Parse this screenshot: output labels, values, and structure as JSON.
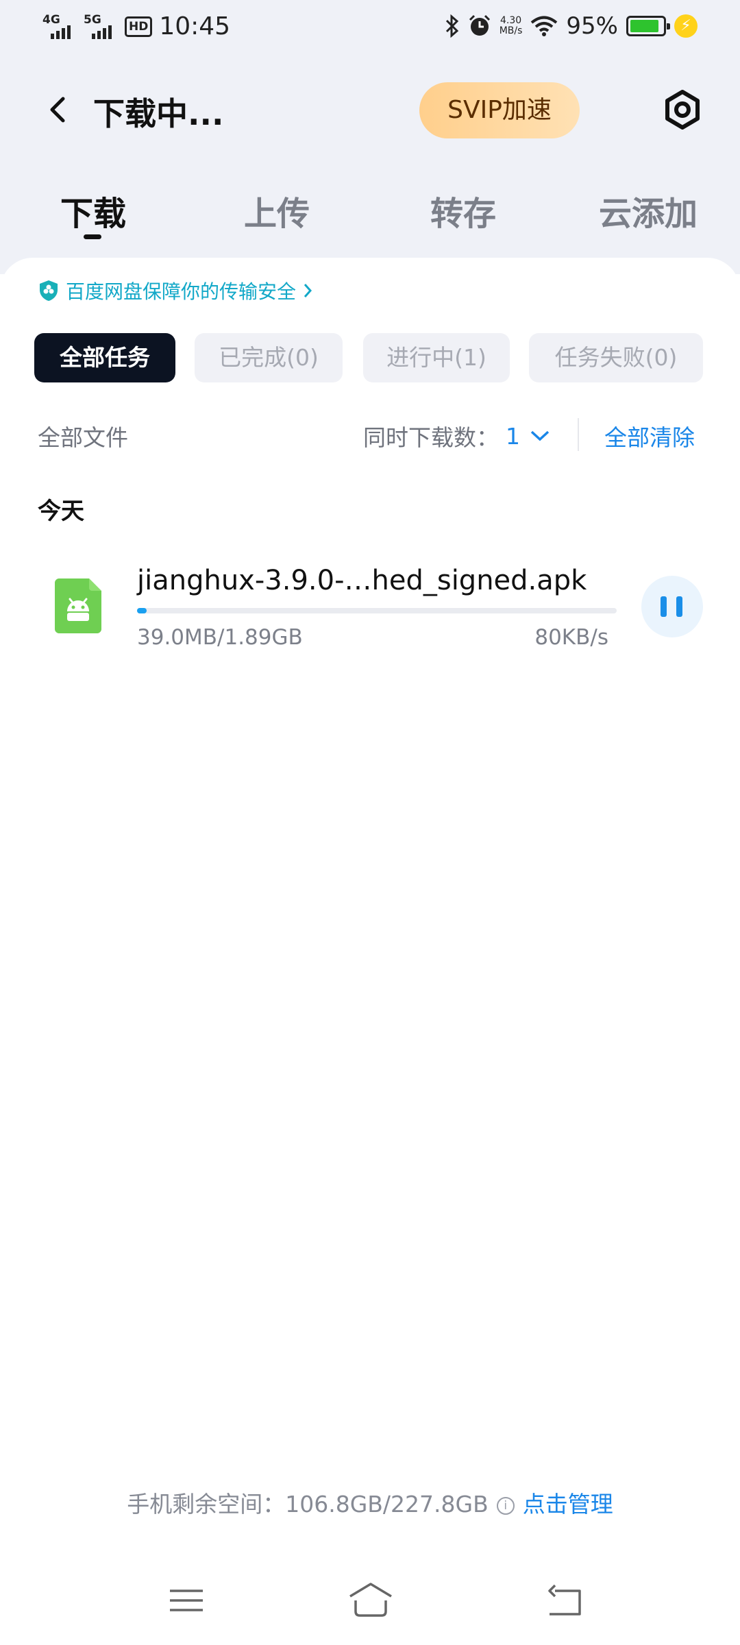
{
  "status_bar": {
    "net1": "4G",
    "net2": "5G",
    "hd": "HD",
    "time": "10:45",
    "speed_value": "4.30",
    "speed_unit": "MB/s",
    "battery_percent": "95%",
    "battery_level": 0.95
  },
  "header": {
    "title": "下载中...",
    "svip_label": "SVIP加速"
  },
  "tabs": [
    {
      "label": "下载",
      "active": true
    },
    {
      "label": "上传",
      "active": false
    },
    {
      "label": "转存",
      "active": false
    },
    {
      "label": "云添加",
      "active": false
    }
  ],
  "security_banner": {
    "text": "百度网盘保障你的传输安全"
  },
  "filter_chips": [
    {
      "label": "全部任务",
      "active": true
    },
    {
      "label": "已完成(0)",
      "active": false
    },
    {
      "label": "进行中(1)",
      "active": false
    },
    {
      "label": "任务失败(0)",
      "active": false
    }
  ],
  "toolbar": {
    "filter_label": "全部文件",
    "concurrent_label": "同时下载数：",
    "concurrent_value": "1",
    "clear_label": "全部清除"
  },
  "group": {
    "label": "今天"
  },
  "download_item": {
    "file_name": "jianghux-3.9.0-…hed_signed.apk",
    "size_text": "39.0MB/1.89GB",
    "speed_text": "80KB/s",
    "progress": 0.0206,
    "icon": "android-apk-icon"
  },
  "footer": {
    "storage_label": "手机剩余空间：106.8GB/227.8GB",
    "info_glyph": "i",
    "manage_label": "点击管理"
  },
  "colors": {
    "accent": "#1a86e8",
    "active_chip": "#0c1322",
    "svip_gradient_start": "#ffcf8c",
    "apk_green": "#6fcf52"
  }
}
